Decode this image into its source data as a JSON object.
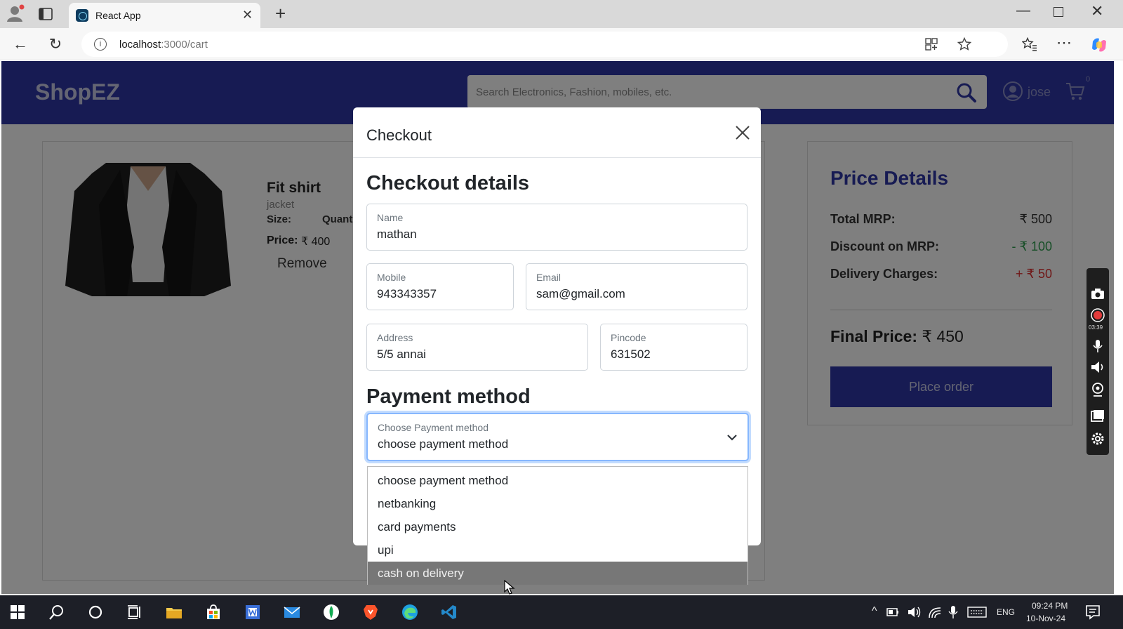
{
  "browser": {
    "tab_title": "React App",
    "tab_close": "✕",
    "new_tab": "+",
    "url_host": "localhost",
    "url_path": ":3000/cart"
  },
  "header": {
    "logo": "ShopEZ",
    "search_placeholder": "Search Electronics, Fashion, mobiles, etc.",
    "username": "jose",
    "cart_count": "0"
  },
  "cart": {
    "product": {
      "title": "Fit shirt",
      "subtitle": "jacket",
      "size_label": "Size:",
      "qty_label": "Quant",
      "price_label": "Price:",
      "price_value": "₹ 400",
      "remove_label": "Remove"
    }
  },
  "price_details": {
    "title": "Price Details",
    "rows": [
      {
        "label": "Total MRP:",
        "value": "₹ 500",
        "color": "#333333"
      },
      {
        "label": "Discount on MRP:",
        "value": "- ₹ 100",
        "color": "#2e9e4f"
      },
      {
        "label": "Delivery Charges:",
        "value": "+ ₹ 50",
        "color": "#e03131"
      }
    ],
    "final_label": "Final Price:",
    "final_value": "₹ 450",
    "place_order": "Place order"
  },
  "modal": {
    "title": "Checkout",
    "details_heading": "Checkout details",
    "fields": {
      "name": {
        "label": "Name",
        "value": "mathan"
      },
      "mobile": {
        "label": "Mobile",
        "value": "943343357"
      },
      "email": {
        "label": "Email",
        "value": "sam@gmail.com"
      },
      "address": {
        "label": "Address",
        "value": "5/5 annai"
      },
      "pincode": {
        "label": "Pincode",
        "value": "631502"
      }
    },
    "payment_heading": "Payment method",
    "payment_select": {
      "label": "Choose Payment method",
      "value": "choose payment method"
    },
    "payment_options": [
      "choose payment method",
      "netbanking",
      "card payments",
      "upi",
      "cash on delivery"
    ],
    "hovered_option": "cash on delivery"
  },
  "recorder": {
    "time": "03:39"
  },
  "taskbar": {
    "language": "ENG",
    "time": "09:24 PM",
    "date": "10-Nov-24"
  },
  "colors": {
    "brand": "#2f36a6",
    "focus_border": "#86b7fe"
  }
}
